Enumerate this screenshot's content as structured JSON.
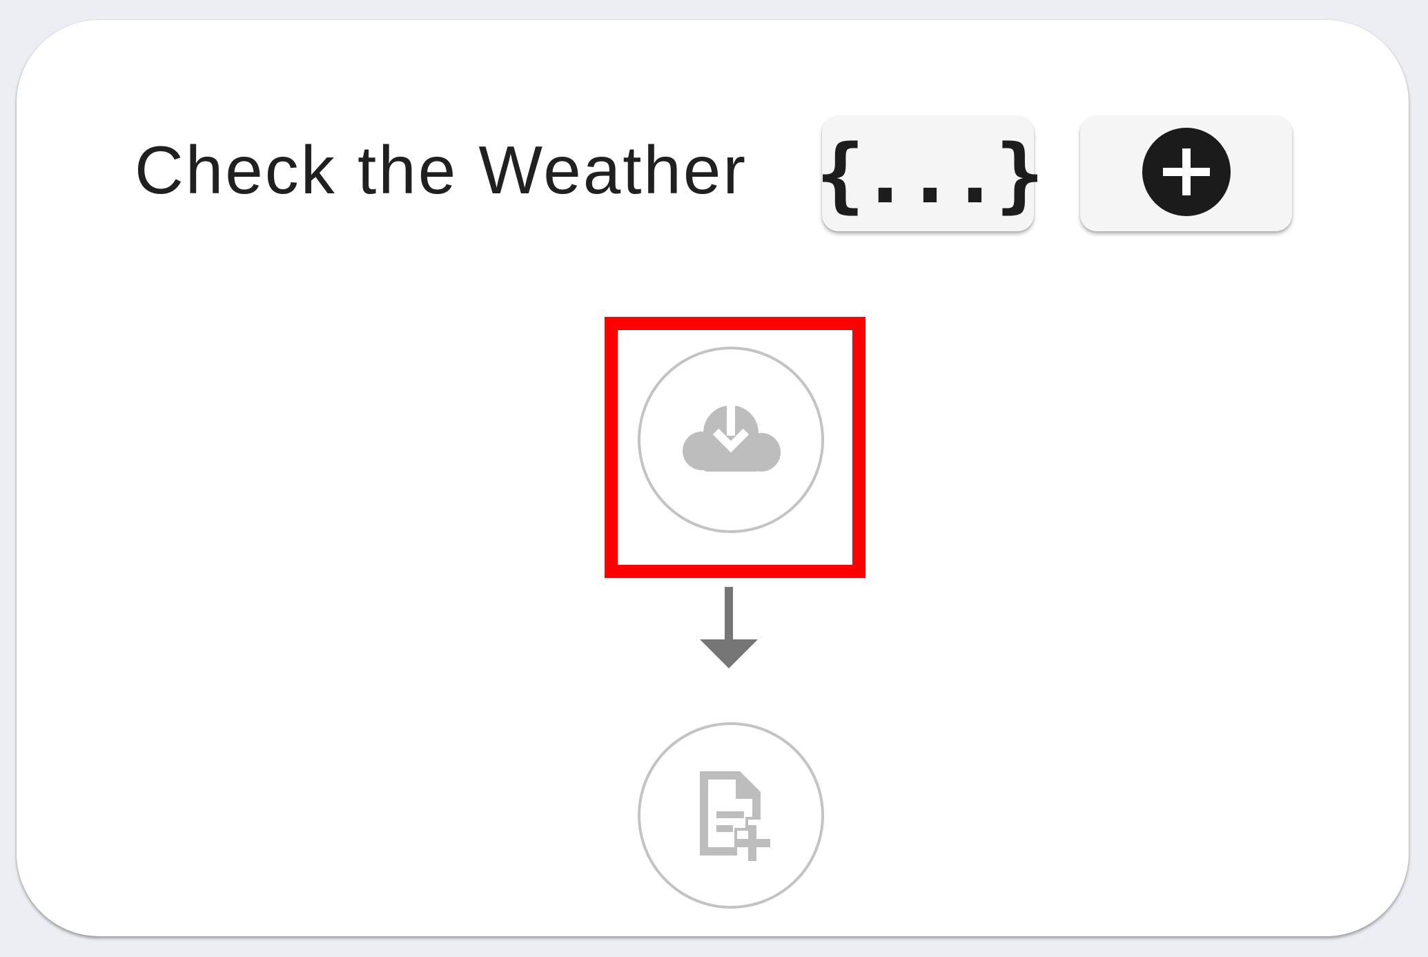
{
  "card": {
    "title": "Check the Weather"
  },
  "toolbar": {
    "variables_label": "{...}",
    "add_icon": "plus-circle-icon"
  },
  "flow": {
    "nodes": [
      {
        "icon": "cloud-download-icon",
        "highlighted": true
      },
      {
        "icon": "document-add-icon",
        "highlighted": false
      }
    ],
    "connector_icon": "arrow-down-icon"
  },
  "colors": {
    "highlight": "#ff0000",
    "node_icon": "#bdbdbd",
    "node_border": "#c3c3c3",
    "arrow": "#767676",
    "button_bg": "#f5f5f5",
    "title_text": "#202020"
  }
}
